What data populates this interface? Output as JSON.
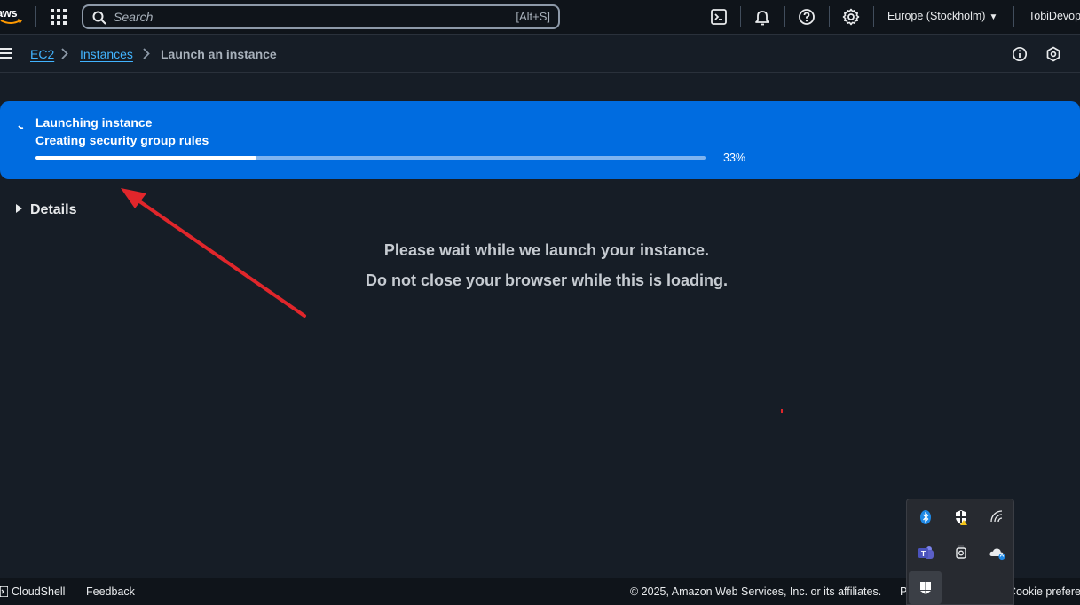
{
  "topnav": {
    "logo_text": "aws",
    "search_placeholder": "Search",
    "search_shortcut": "[Alt+S]",
    "region": "Europe (Stockholm)",
    "account": "TobiDevop",
    "icons": [
      "services-grid-icon",
      "cloudshell-icon",
      "bell-icon",
      "help-icon",
      "gear-icon"
    ]
  },
  "breadcrumb": {
    "items": [
      "EC2",
      "Instances",
      "Launch an instance"
    ]
  },
  "flash": {
    "title": "Launching instance",
    "subtitle": "Creating security group rules",
    "progress_label": "33%",
    "progress_value": 0.33,
    "color": "#006ce0"
  },
  "main": {
    "details_label": "Details",
    "wait_line_1": "Please wait while we launch your instance.",
    "wait_line_2": "Do not close your browser while this is loading."
  },
  "footer": {
    "cloudshell": "CloudShell",
    "feedback": "Feedback",
    "copyright": "© 2025, Amazon Web Services, Inc. or its affiliates.",
    "privacy": "P",
    "cookie": "Cookie prefere"
  },
  "tray": {
    "icons": [
      "bluetooth-icon",
      "security-shield-icon",
      "wifi-icon",
      "teams-icon",
      "camera-icon",
      "cloud-sync-icon",
      "app-icon"
    ]
  },
  "colors": {
    "background": "#161d26",
    "nav": "#0f141a",
    "link": "#42b4ff",
    "annotation_arrow": "#e0262b"
  }
}
